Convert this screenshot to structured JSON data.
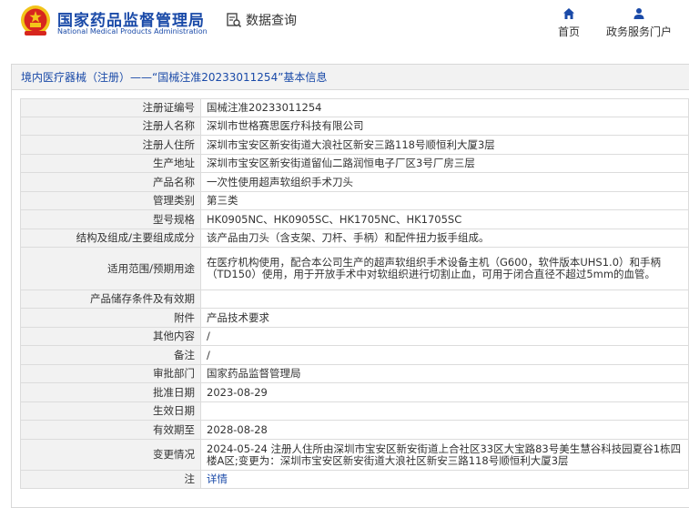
{
  "header": {
    "brand_cn": "国家药品监督管理局",
    "brand_en": "National Medical Products Administration",
    "query_label": "数据查询",
    "nav": [
      {
        "label": "首页",
        "icon": "home-icon"
      },
      {
        "label": "政务服务门户",
        "icon": "user-icon"
      }
    ]
  },
  "breadcrumb": "境内医疗器械（注册）——“国械注准20233011254”基本信息",
  "rows": [
    {
      "label": "注册证编号",
      "value": "国械注准20233011254"
    },
    {
      "label": "注册人名称",
      "value": "深圳市世格赛思医疗科技有限公司"
    },
    {
      "label": "注册人住所",
      "value": "深圳市宝安区新安街道大浪社区新安三路118号顺恒利大厦3层"
    },
    {
      "label": "生产地址",
      "value": "深圳市宝安区新安街道留仙二路润恒电子厂区3号厂房三层"
    },
    {
      "label": "产品名称",
      "value": "一次性使用超声软组织手术刀头"
    },
    {
      "label": "管理类别",
      "value": "第三类"
    },
    {
      "label": "型号规格",
      "value": "HK0905NC、HK0905SC、HK1705NC、HK1705SC"
    },
    {
      "label": "结构及组成/主要组成成分",
      "value": "该产品由刀头（含支架、刀杆、手柄）和配件扭力扳手组成。"
    },
    {
      "label": "适用范围/预期用途",
      "value": "在医疗机构使用，配合本公司生产的超声软组织手术设备主机（G600，软件版本UHS1.0）和手柄（TD150）使用，用于开放手术中对软组织进行切割止血，可用于闭合直径不超过5mm的血管。"
    },
    {
      "label": "产品储存条件及有效期",
      "value": ""
    },
    {
      "label": "附件",
      "value": "产品技术要求"
    },
    {
      "label": "其他内容",
      "value": "/"
    },
    {
      "label": "备注",
      "value": "/"
    },
    {
      "label": "审批部门",
      "value": "国家药品监督管理局"
    },
    {
      "label": "批准日期",
      "value": "2023-08-29"
    },
    {
      "label": "生效日期",
      "value": ""
    },
    {
      "label": "有效期至",
      "value": "2028-08-28"
    },
    {
      "label": "变更情况",
      "value": "2024-05-24 注册人住所由深圳市宝安区新安街道上合社区33区大宝路83号美生慧谷科技园夏谷1栋四楼A区;变更为：深圳市宝安区新安街道大浪社区新安三路118号顺恒利大厦3层"
    },
    {
      "label": "注",
      "value": "详情",
      "is_link": true
    }
  ],
  "colors": {
    "brand": "#1a4aa8",
    "label_bg": "#f2f2f2",
    "border": "#dcdcdc",
    "logo_red": "#d7261e",
    "logo_gold": "#f2c41a"
  }
}
